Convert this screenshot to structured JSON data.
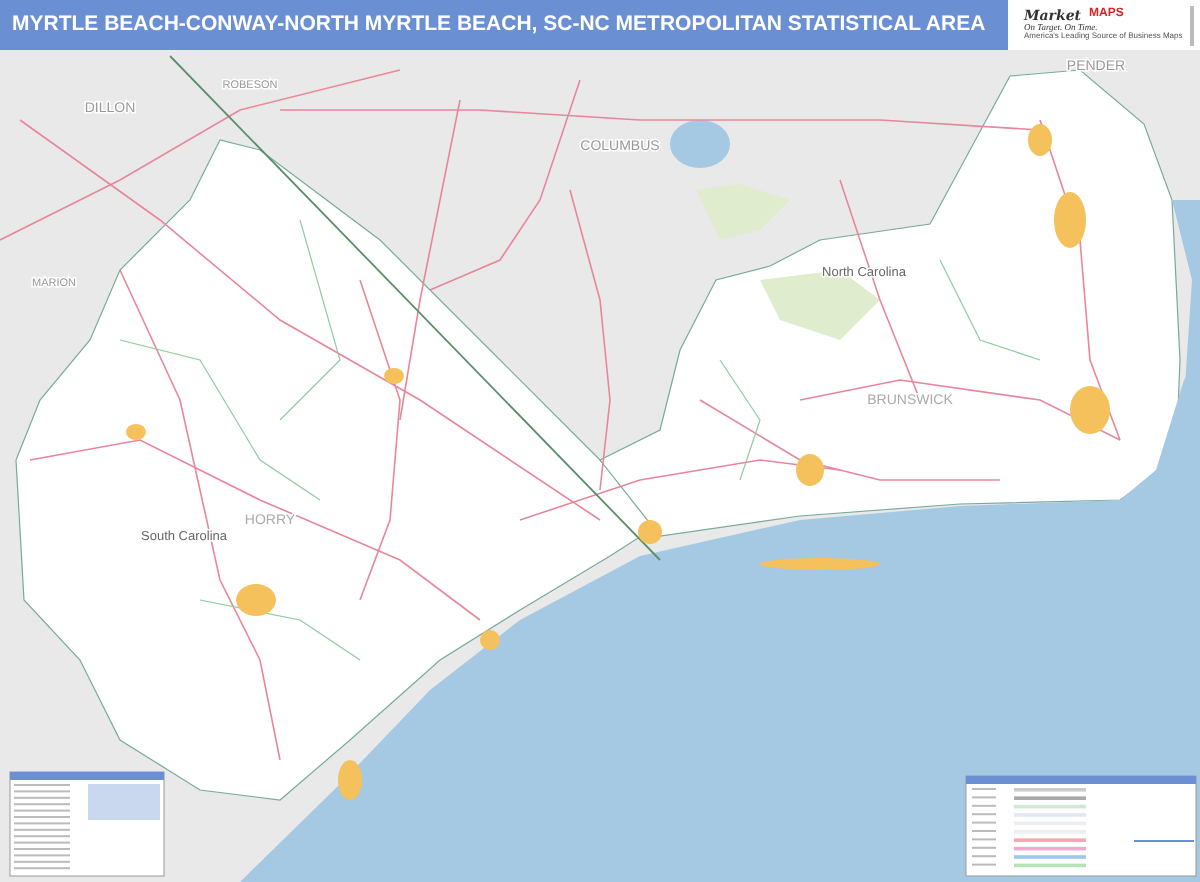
{
  "header": {
    "title": "MYRTLE BEACH-CONWAY-NORTH MYRTLE BEACH, SC-NC METROPOLITAN STATISTICAL AREA"
  },
  "logo": {
    "brand": "Market",
    "brand_emphasis": "MAPS",
    "tagline": "On Target. On Time.",
    "slogan": "America's Leading Source of Business Maps"
  },
  "map": {
    "labels": [
      {
        "text": "DILLON",
        "kind": "county"
      },
      {
        "text": "ROBESON",
        "kind": "county-small"
      },
      {
        "text": "COLUMBUS",
        "kind": "county"
      },
      {
        "text": "PENDER",
        "kind": "county"
      },
      {
        "text": "MARION",
        "kind": "county-small"
      },
      {
        "text": "North Carolina",
        "kind": "state"
      },
      {
        "text": "South Carolina",
        "kind": "state"
      },
      {
        "text": "HORRY",
        "kind": "county-msa"
      },
      {
        "text": "BRUNSWICK",
        "kind": "county-msa"
      }
    ]
  }
}
